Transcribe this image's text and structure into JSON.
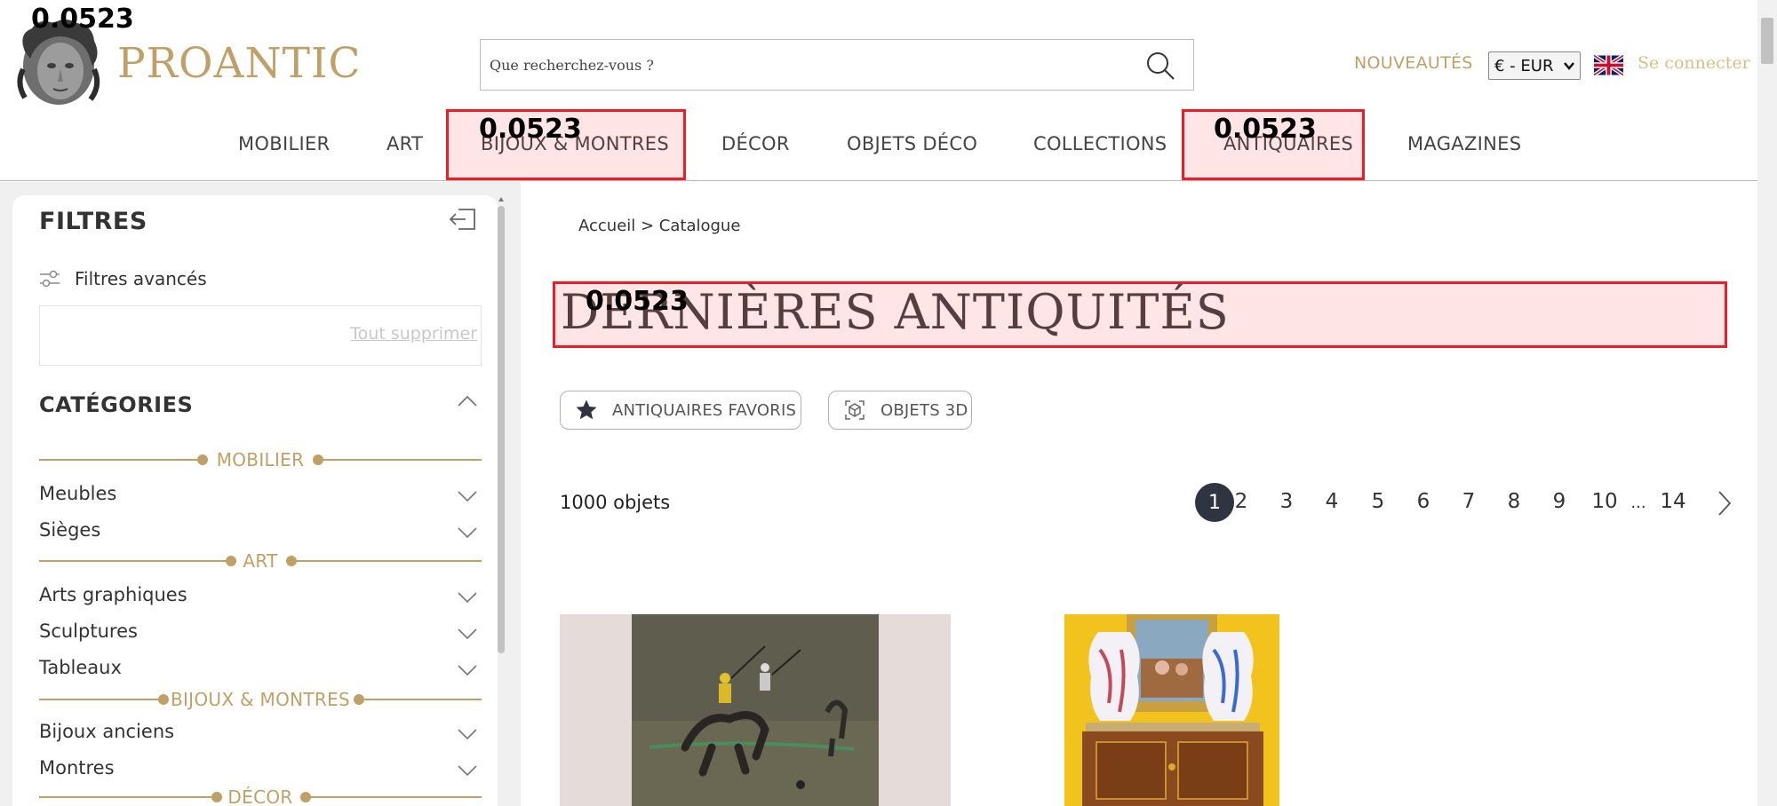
{
  "header": {
    "logo_text": "PROANTIC",
    "search_placeholder": "Que recherchez-vous ?",
    "nouveautes_label": "NOUVEAUTÉS",
    "currency_value": "€ - EUR",
    "language_flag": "uk-flag-icon",
    "signin_label": "Se connecter"
  },
  "nav": {
    "items": [
      "MOBILIER",
      "ART",
      "BIJOUX & MONTRES",
      "DÉCOR",
      "OBJETS DÉCO",
      "COLLECTIONS",
      "ANTIQUAIRES",
      "MAGAZINES"
    ]
  },
  "annotations": {
    "labels": [
      "0.0523",
      "0.0523",
      "0.0523",
      "0.0523"
    ]
  },
  "sidebar": {
    "title": "FILTRES",
    "advanced_filters_label": "Filtres avancés",
    "clear_all_label": "Tout supprimer",
    "categories_title": "CATÉGORIES",
    "groups": [
      {
        "label": "MOBILIER",
        "items": [
          "Meubles",
          "Sièges"
        ]
      },
      {
        "label": "ART",
        "items": [
          "Arts graphiques",
          "Sculptures",
          "Tableaux"
        ]
      },
      {
        "label": "BIJOUX & MONTRES",
        "items": [
          "Bijoux anciens",
          "Montres"
        ]
      },
      {
        "label": "DÉCOR",
        "items": []
      }
    ]
  },
  "main": {
    "breadcrumb": "Accueil > Catalogue",
    "title": "DERNIÈRES ANTIQUITÉS",
    "chips": [
      {
        "label": "ANTIQUAIRES FAVORIS",
        "icon": "star-icon"
      },
      {
        "label": "OBJETS 3D",
        "icon": "cube-3d-icon"
      }
    ],
    "results_count": "1000 objets",
    "pagination": {
      "current": "1",
      "pages": [
        "1",
        "2",
        "3",
        "4",
        "5",
        "6",
        "7",
        "8",
        "9",
        "10"
      ],
      "ellipsis": "...",
      "last": "14"
    }
  },
  "colors": {
    "brand_gold": "#c0a066",
    "active_page": "#2f3540",
    "annotation_red": "#ee1c25"
  }
}
